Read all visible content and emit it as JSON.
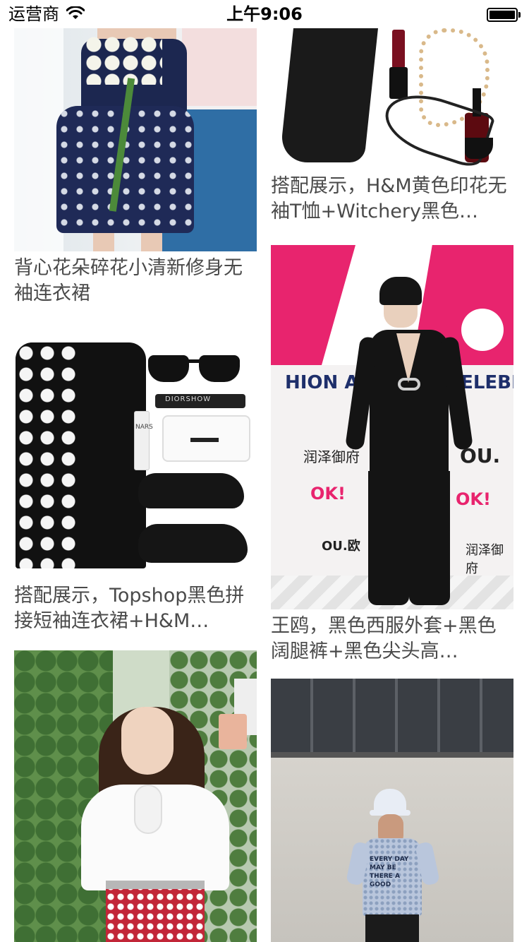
{
  "status_bar": {
    "carrier": "运营商",
    "time": "上午9:06",
    "wifi_icon": "wifi-icon",
    "battery_icon": "battery-icon"
  },
  "feed": {
    "items": [
      {
        "caption": "背心花朵碎花小清新修身无袖连衣裙",
        "image": "floral-dress-photo"
      },
      {
        "caption": "搭配展示，H&M黄色印花无袖T恤+Witchery黑色…",
        "image": "black-outfit-accessories-photo"
      },
      {
        "caption": "搭配展示，Topshop黑色拼接短袖连衣裙+H&M…",
        "image": "polka-dot-dress-set-photo"
      },
      {
        "caption": "王鸥，黑色西服外套+黑色阔腿裤+黑色尖头高…",
        "image": "black-suit-event-photo"
      },
      {
        "caption": "",
        "image": "white-blouse-garden-photo"
      },
      {
        "caption": "",
        "image": "printed-shirt-street-photo"
      }
    ]
  },
  "photo_text": {
    "ok_logo": "OK!",
    "banner": "HION ATTITUD",
    "banner_right": "CELEBRIT",
    "sponsor1": "润泽御府",
    "sponsor2": "OU.",
    "sponsor3": "OU.欧",
    "shirt_text": "EVERY DAY MAY BE THERE A GOOD",
    "mascara_brand": "DIORSHOW",
    "primer_brand": "NARS"
  }
}
